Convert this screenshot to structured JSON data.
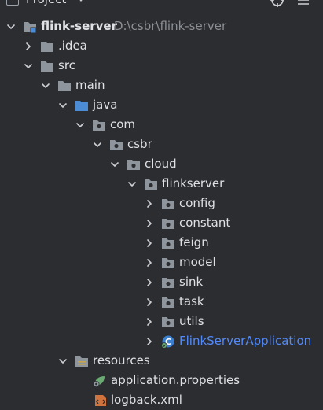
{
  "header": {
    "title": "Project",
    "icons": [
      "project-icon",
      "dropdown-caret-icon",
      "target-icon",
      "options-icon"
    ]
  },
  "tree": {
    "root": {
      "label": "flink-server",
      "path": "D:\\csbr\\flink-server",
      "icon": "module-folder-icon"
    },
    "idea": {
      "label": ".idea",
      "icon": "folder-icon"
    },
    "src": {
      "label": "src",
      "icon": "folder-icon"
    },
    "main": {
      "label": "main",
      "icon": "folder-icon"
    },
    "java": {
      "label": "java",
      "icon": "source-root-folder-icon"
    },
    "com": {
      "label": "com",
      "icon": "package-icon"
    },
    "csbr": {
      "label": "csbr",
      "icon": "package-icon"
    },
    "cloud": {
      "label": "cloud",
      "icon": "package-icon"
    },
    "flinkserver": {
      "label": "flinkserver",
      "icon": "package-icon"
    },
    "packages": [
      {
        "label": "config",
        "icon": "package-icon"
      },
      {
        "label": "constant",
        "icon": "package-icon"
      },
      {
        "label": "feign",
        "icon": "package-icon"
      },
      {
        "label": "model",
        "icon": "package-icon"
      },
      {
        "label": "sink",
        "icon": "package-icon"
      },
      {
        "label": "task",
        "icon": "package-icon"
      },
      {
        "label": "utils",
        "icon": "package-icon"
      }
    ],
    "app_class": {
      "label": "FlinkServerApplication",
      "icon": "spring-boot-class-icon"
    },
    "resources": {
      "label": "resources",
      "icon": "resources-folder-icon"
    },
    "app_props": {
      "label": "application.properties",
      "icon": "spring-properties-icon"
    },
    "logback": {
      "label": "logback.xml",
      "icon": "xml-file-icon"
    }
  },
  "colors": {
    "background": "#2b2d30",
    "text": "#dfe1e5",
    "path_text": "#8c8f94",
    "class_name": "#548af7",
    "folder": "#8f959d",
    "source_folder": "#4c8cd4"
  }
}
